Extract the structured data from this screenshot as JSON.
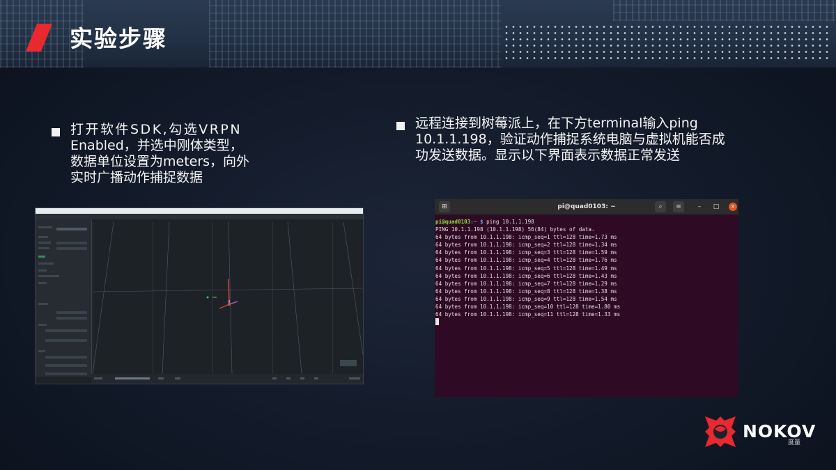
{
  "header": {
    "title": "实验步骤"
  },
  "bullets": {
    "left_lines": [
      "打开软件SDK,勾选VRPN",
      "Enabled，并选中刚体类型，",
      "数据单位设置为meters，向外",
      "实时广播动作捕捉数据"
    ],
    "right_lines": [
      "远程连接到树莓派上，在下方terminal输入ping",
      "10.1.1.198，验证动作捕捉系统电脑与虚拟机能否成",
      "功发送数据。显示以下界面表示数据正常发送"
    ]
  },
  "terminal": {
    "window_title": "pi@quad0103: ~",
    "prompt_user": "pi@quad0103",
    "prompt_path": ":~ $ ",
    "command": "ping 10.1.1.198",
    "header_line": "PING 10.1.1.198 (10.1.1.198) 56(84) bytes of data.",
    "lines": [
      "64 bytes from 10.1.1.198: icmp_seq=1 ttl=128 time=1.73 ms",
      "64 bytes from 10.1.1.198: icmp_seq=2 ttl=128 time=1.34 ms",
      "64 bytes from 10.1.1.198: icmp_seq=3 ttl=128 time=1.59 ms",
      "64 bytes from 10.1.1.198: icmp_seq=4 ttl=128 time=1.76 ms",
      "64 bytes from 10.1.1.198: icmp_seq=5 ttl=128 time=1.49 ms",
      "64 bytes from 10.1.1.198: icmp_seq=6 ttl=128 time=1.43 ms",
      "64 bytes from 10.1.1.198: icmp_seq=7 ttl=128 time=1.29 ms",
      "64 bytes from 10.1.1.198: icmp_seq=8 ttl=128 time=1.38 ms",
      "64 bytes from 10.1.1.198: icmp_seq=9 ttl=128 time=1.54 ms",
      "64 bytes from 10.1.1.198: icmp_seq=10 ttl=128 time=1.80 ms",
      "64 bytes from 10.1.1.198: icmp_seq=11 ttl=128 time=1.33 ms"
    ],
    "icons": {
      "tab": "new-tab-icon",
      "search": "search-icon",
      "menu": "hamburger-menu-icon",
      "minimize": "minimize-icon",
      "maximize": "maximize-icon",
      "close": "close-icon"
    }
  },
  "logo": {
    "name": "NOKOV",
    "subtitle": "度量"
  },
  "colors": {
    "accent_red": "#e8292d",
    "terminal_bg": "#2f0a24",
    "terminal_close": "#e95420"
  }
}
